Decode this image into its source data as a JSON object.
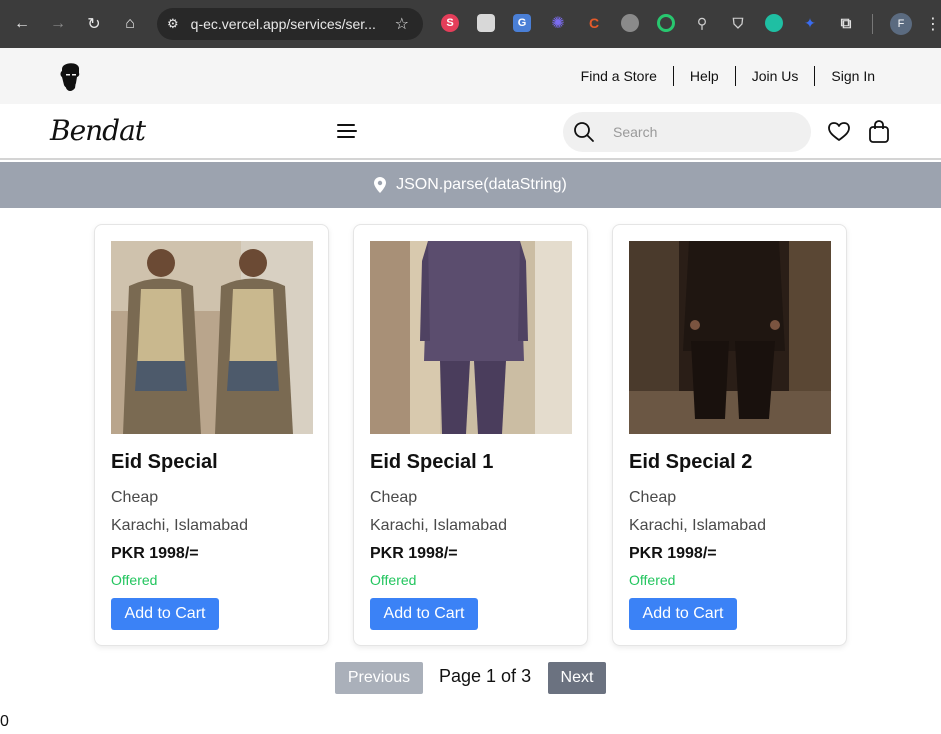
{
  "browser": {
    "url": "q-ec.vercel.app/services/ser...",
    "profile_initial": "F"
  },
  "top_bar": {
    "links": [
      "Find a Store",
      "Help",
      "Join Us",
      "Sign In"
    ]
  },
  "header": {
    "logo_text": "Bendat",
    "search_placeholder": "Search"
  },
  "location_band": {
    "text": "JSON.parse(dataString)"
  },
  "products": [
    {
      "title": "Eid Special",
      "subtitle": "Cheap",
      "cities": "Karachi, Islamabad",
      "price": "PKR 1998/=",
      "status": "Offered",
      "button": "Add to Cart"
    },
    {
      "title": "Eid Special 1",
      "subtitle": "Cheap",
      "cities": "Karachi, Islamabad",
      "price": "PKR 1998/=",
      "status": "Offered",
      "button": "Add to Cart"
    },
    {
      "title": "Eid Special 2",
      "subtitle": "Cheap",
      "cities": "Karachi, Islamabad",
      "price": "PKR 1998/=",
      "status": "Offered",
      "button": "Add to Cart"
    }
  ],
  "pagination": {
    "previous_label": "Previous",
    "page_info": "Page 1 of 3",
    "next_label": "Next"
  },
  "footer": {
    "counter": "0"
  },
  "colors": {
    "accent": "#3b82f6",
    "offer": "#22c55e",
    "band": "#9ca3af"
  }
}
